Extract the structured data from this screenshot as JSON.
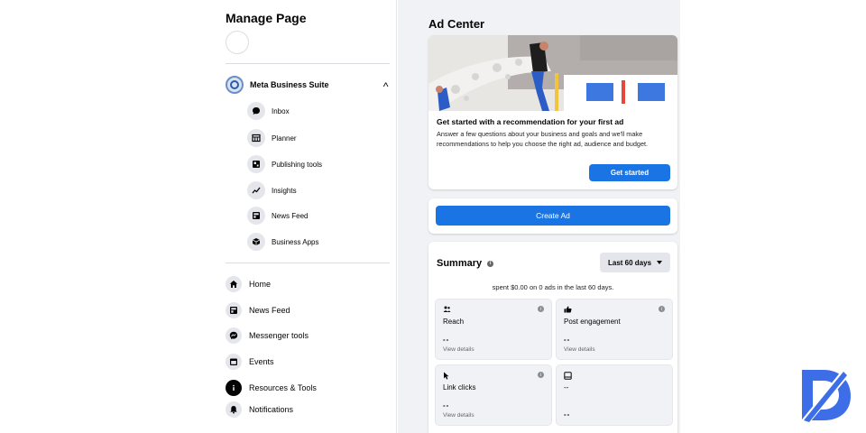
{
  "sidebar": {
    "title": "Manage Page",
    "business_suite": {
      "label": "Meta Business Suite",
      "chevron": "˄"
    },
    "sub_items": [
      {
        "label": "Inbox",
        "icon": "chat-icon"
      },
      {
        "label": "Planner",
        "icon": "calendar-grid-icon"
      },
      {
        "label": "Publishing tools",
        "icon": "publishing-icon"
      },
      {
        "label": "Insights",
        "icon": "insights-icon"
      },
      {
        "label": "News Feed",
        "icon": "news-feed-icon"
      },
      {
        "label": "Business Apps",
        "icon": "box-icon"
      }
    ],
    "main_items": [
      {
        "label": "Home",
        "icon": "home-icon"
      },
      {
        "label": "News Feed",
        "icon": "news-feed-icon"
      },
      {
        "label": "Messenger tools",
        "icon": "messenger-icon"
      },
      {
        "label": "Events",
        "icon": "calendar-icon"
      },
      {
        "label": "Resources & Tools",
        "icon": "info-icon"
      },
      {
        "label": "Notifications",
        "icon": "bell-icon"
      }
    ]
  },
  "main": {
    "title": "Ad Center",
    "promo": {
      "heading": "Get started with a recommendation for your first ad",
      "text": "Answer a few questions about your business and goals and we'll make recommendations to help you choose the right ad, audience and budget.",
      "button": "Get started"
    },
    "create_ad": "Create Ad",
    "summary": {
      "title": "Summary",
      "period": "Last 60 days",
      "spent_text": "spent $0.00 on 0 ads in the last 60 days.",
      "metrics": [
        {
          "label": "Reach",
          "value": "--",
          "link": "View details",
          "icon": "people-icon",
          "has_info": true
        },
        {
          "label": "Post engagement",
          "value": "--",
          "link": "View details",
          "icon": "thumbs-up-icon",
          "has_info": true
        },
        {
          "label": "Link clicks",
          "value": "--",
          "link": "View details",
          "icon": "cursor-icon",
          "has_info": true
        },
        {
          "label": "--",
          "value": "--",
          "link": "",
          "icon": "screen-icon",
          "has_info": false
        }
      ]
    }
  },
  "colors": {
    "primary": "#1b74e4",
    "page_bg": "#f0f2f5",
    "logo": "#3d6ee8"
  }
}
